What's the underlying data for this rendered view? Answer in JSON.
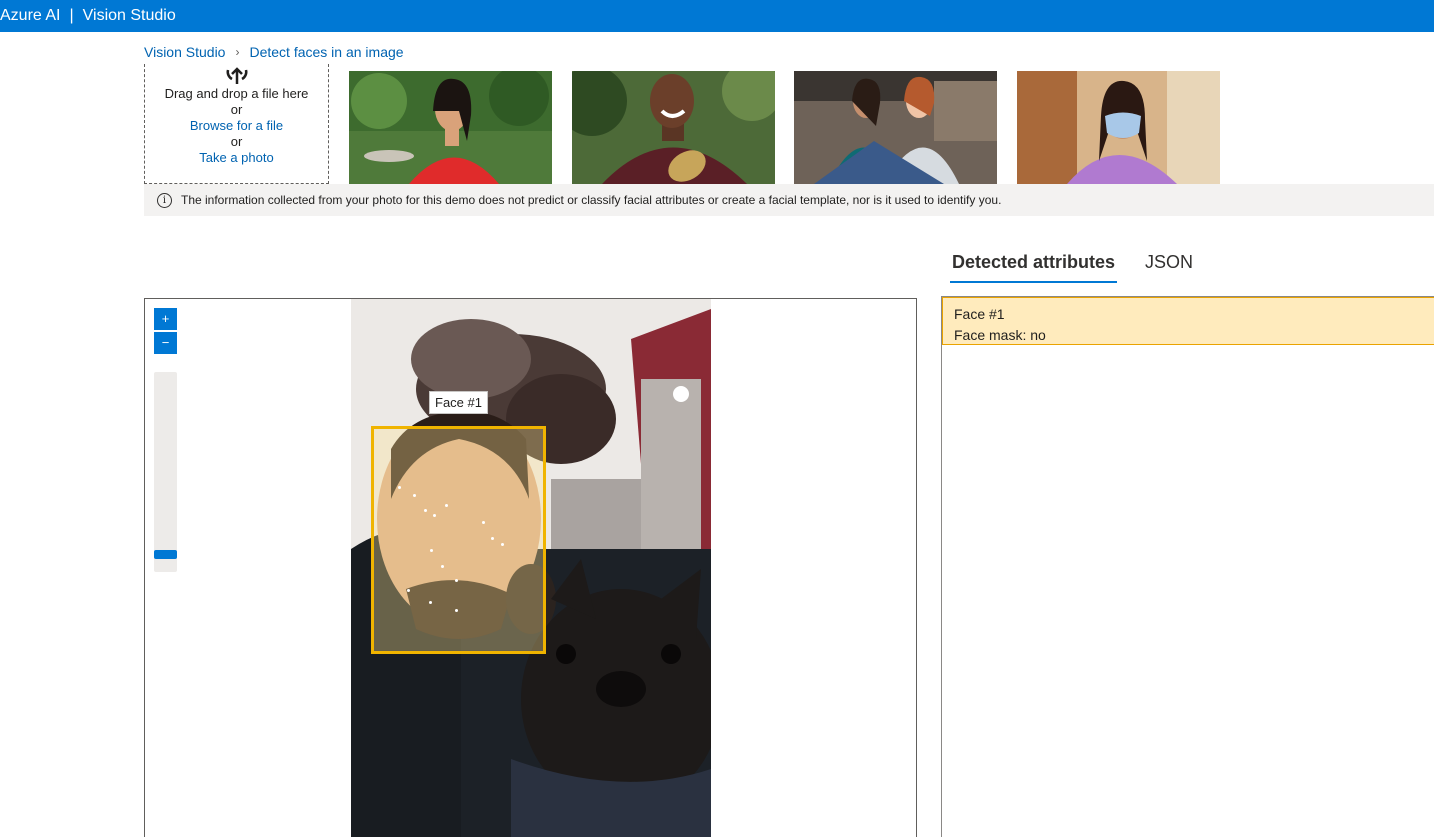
{
  "topbar": {
    "brand": "Azure AI",
    "separator": "|",
    "product": "Vision Studio"
  },
  "breadcrumb": {
    "root": "Vision Studio",
    "separator": "›",
    "current": "Detect faces in an image"
  },
  "upload": {
    "line1": "Drag and drop a file here",
    "or1": "or",
    "browse": "Browse for a file",
    "or2": "or",
    "photo": "Take a photo"
  },
  "samples": [
    {
      "name": "sample-woman-red-top"
    },
    {
      "name": "sample-man-maroon-shirt"
    },
    {
      "name": "sample-two-women-office"
    },
    {
      "name": "sample-woman-face-mask"
    }
  ],
  "notice": {
    "text": "The information collected from your photo for this demo does not predict or classify facial attributes or create a facial template, nor is it used to identify you."
  },
  "tabs": [
    {
      "label": "Detected attributes",
      "active": true
    },
    {
      "label": "JSON",
      "active": false
    }
  ],
  "viewer": {
    "zoom_in": "+",
    "zoom_out": "−",
    "zoom_level": 0.1,
    "face_label": "Face #1"
  },
  "attributes": {
    "face_title": "Face #1",
    "face_mask": "Face mask: no"
  },
  "colors": {
    "accent": "#0078d4",
    "face_box": "#f0b400",
    "highlight_bg": "#ffebbd"
  }
}
